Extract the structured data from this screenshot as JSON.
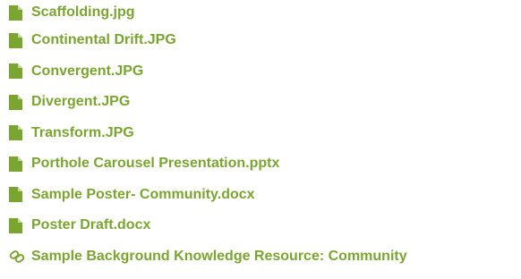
{
  "accent_color": "#7aa530",
  "items": [
    {
      "label": "Scaffolding.jpg",
      "icon": "file-icon"
    },
    {
      "label": "Continental Drift.JPG",
      "icon": "file-icon"
    },
    {
      "label": "Convergent.JPG",
      "icon": "file-icon"
    },
    {
      "label": "Divergent.JPG",
      "icon": "file-icon"
    },
    {
      "label": "Transform.JPG",
      "icon": "file-icon"
    },
    {
      "label": "Porthole Carousel Presentation.pptx",
      "icon": "file-icon"
    },
    {
      "label": "Sample Poster- Community.docx",
      "icon": "file-icon"
    },
    {
      "label": "Poster Draft.docx",
      "icon": "file-icon"
    },
    {
      "label": "Sample Background Knowledge Resource: Community",
      "icon": "link-icon"
    }
  ]
}
